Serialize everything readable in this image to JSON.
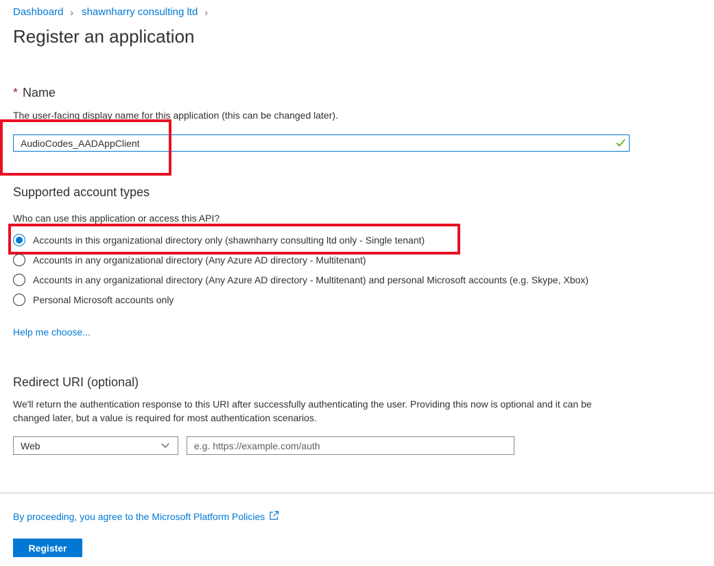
{
  "breadcrumb": {
    "items": [
      {
        "label": "Dashboard"
      },
      {
        "label": "shawnharry consulting ltd"
      }
    ]
  },
  "page_title": "Register an application",
  "name_section": {
    "required_marker": "*",
    "heading": "Name",
    "description": "The user-facing display name for this application (this can be changed later).",
    "value": "AudioCodes_AADAppClient"
  },
  "account_types": {
    "heading": "Supported account types",
    "question": "Who can use this application or access this API?",
    "options": [
      {
        "label": "Accounts in this organizational directory only (shawnharry consulting ltd only - Single tenant)",
        "checked": true
      },
      {
        "label": "Accounts in any organizational directory (Any Azure AD directory - Multitenant)",
        "checked": false
      },
      {
        "label": "Accounts in any organizational directory (Any Azure AD directory - Multitenant) and personal Microsoft accounts (e.g. Skype, Xbox)",
        "checked": false
      },
      {
        "label": "Personal Microsoft accounts only",
        "checked": false
      }
    ],
    "help_link": "Help me choose..."
  },
  "redirect": {
    "heading": "Redirect URI (optional)",
    "description_line1": "We'll return the authentication response to this URI after successfully authenticating the user. Providing this now is optional and it can be",
    "description_line2": "changed later, but a value is required for most authentication scenarios.",
    "platform_selected": "Web",
    "uri_placeholder": "e.g. https://example.com/auth",
    "uri_value": ""
  },
  "footer": {
    "policy_link": "By proceeding, you agree to the Microsoft Platform Policies",
    "register_label": "Register"
  },
  "colors": {
    "accent": "#0078d4",
    "highlight": "#e81123",
    "valid": "#57a300",
    "required": "#a4262c"
  }
}
